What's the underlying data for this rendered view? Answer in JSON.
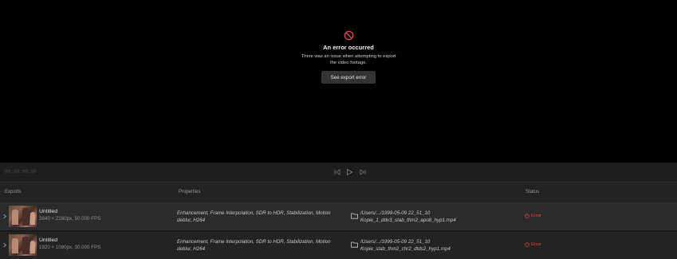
{
  "preview": {
    "error_title": "An error occurred",
    "error_message": "There was an issue when attempting to export the video footage.",
    "error_button": "See export error"
  },
  "transport": {
    "timecode": "00:00:00:00"
  },
  "columns": {
    "exports": "Exports",
    "properties": "Properties",
    "status": "Status"
  },
  "exports": [
    {
      "name": "Untitled",
      "meta": "3840 × 2160px, 50.000 FPS",
      "properties": "Enhancement, Frame Interpolation, SDR to HDR, Stabilization, Motion deblur, H264",
      "path_line1": "/Users/.../1999-05-09 22_51_10",
      "path_line2": "Kopie_1_ddv3_stab_thm2_apo8_hyp1.mp4",
      "status": "Error"
    },
    {
      "name": "Untitled",
      "meta": "1920 × 1080px, 30.000 FPS",
      "properties": "Enhancement, Frame Interpolation, SDR to HDR, Stabilization, Motion deblur, H264",
      "path_line1": "/Users/.../1999-05-09 22_51_10",
      "path_line2": "Kopie_stab_thm2_chr2_dtds2_hyp1.mp4",
      "status": "Error"
    }
  ],
  "colors": {
    "error_red": "#d0454f",
    "background": "#1b1b1b",
    "preview_bg": "#000000"
  },
  "icons": [
    "prohibited-icon",
    "step-back-icon",
    "play-icon",
    "step-forward-icon",
    "chevron-right-icon",
    "folder-icon",
    "error-circle-icon"
  ]
}
